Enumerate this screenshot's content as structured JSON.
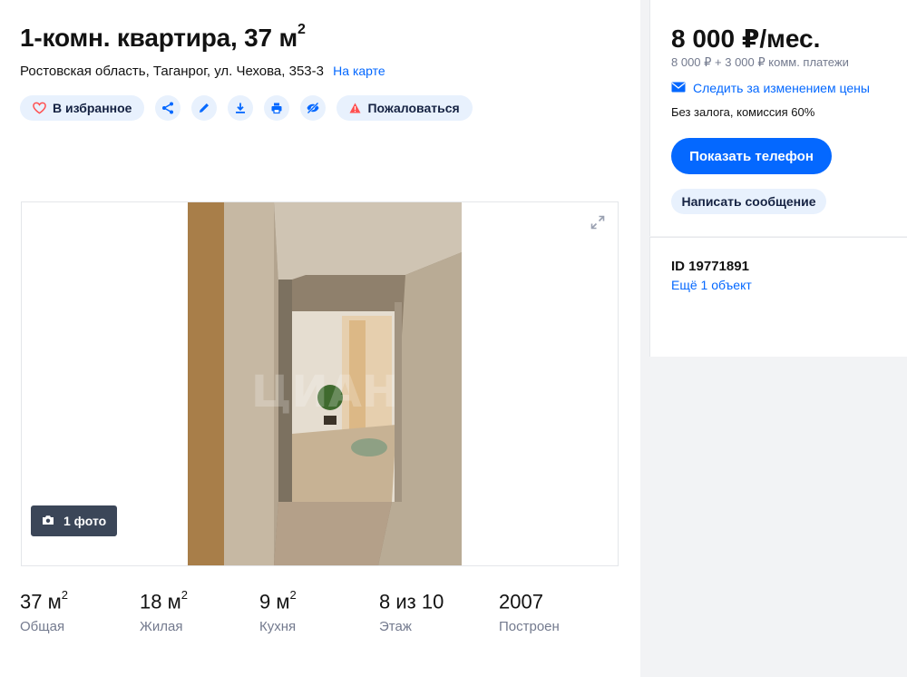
{
  "header": {
    "title": "1-комн. квартира, 37 м",
    "title_sup": "2",
    "address": "Ростовская область, Таганрог, ул. Чехова, 353-3",
    "map_link": "На карте"
  },
  "actions": {
    "favorite_label": "В избранное",
    "complain_label": "Пожаловаться",
    "icons": [
      "heart-icon",
      "share-icon",
      "pencil-icon",
      "download-icon",
      "print-icon",
      "hide-icon",
      "warning-icon"
    ]
  },
  "gallery": {
    "photo_count_label": "1 фото"
  },
  "facts": [
    {
      "value": "37 м",
      "sup": "2",
      "label": "Общая"
    },
    {
      "value": "18 м",
      "sup": "2",
      "label": "Жилая"
    },
    {
      "value": "9 м",
      "sup": "2",
      "label": "Кухня"
    },
    {
      "value": "8 из 10",
      "sup": "",
      "label": "Этаж"
    },
    {
      "value": "2007",
      "sup": "",
      "label": "Построен"
    }
  ],
  "sidebar": {
    "price": "8 000 ₽/мес.",
    "price_breakdown": "8 000 ₽ + 3 000 ₽ комм. платежи",
    "watch_price": "Следить за изменением цены",
    "terms": "Без залога, комиссия 60%",
    "phone_button": "Показать телефон",
    "message_button": "Написать сообщение",
    "listing_id": "ID 19771891",
    "more_objects": "Ещё 1 объект"
  },
  "colors": {
    "accent": "#0468ff",
    "pill_bg": "#e8f1fd",
    "warning": "#ff5050",
    "heart": "#ff5050"
  }
}
